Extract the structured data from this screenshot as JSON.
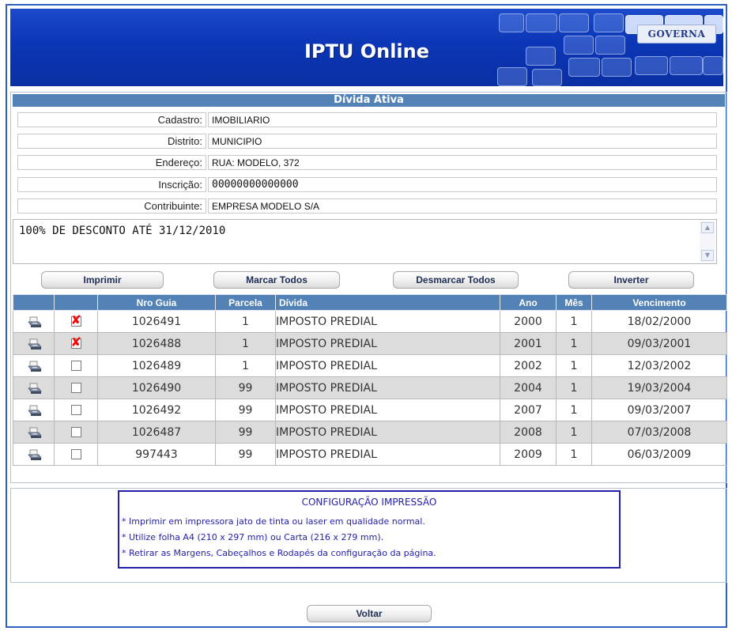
{
  "header": {
    "title": "IPTU Online",
    "logo_text": "GOVERNA"
  },
  "section_title": "Dívida Ativa",
  "fields": [
    {
      "label": "Cadastro:",
      "value": "IMOBILIARIO"
    },
    {
      "label": "Distrito:",
      "value": "MUNICIPIO"
    },
    {
      "label": "Endereço:",
      "value": "RUA: MODELO, 372"
    },
    {
      "label": "Inscrição:",
      "value": "00000000000000"
    },
    {
      "label": "Contribuinte:",
      "value": "EMPRESA MODELO S/A"
    }
  ],
  "message": "100% DE DESCONTO ATÉ 31/12/2010",
  "buttons": {
    "print": "Imprimir",
    "select_all": "Marcar Todos",
    "deselect_all": "Desmarcar Todos",
    "invert": "Inverter",
    "back": "Voltar"
  },
  "table": {
    "columns": [
      "",
      "",
      "Nro Guia",
      "Parcela",
      "Dívida",
      "Ano",
      "Mês",
      "Vencimento"
    ],
    "rows": [
      {
        "checked": true,
        "guia": "1026491",
        "parcela": "1",
        "divida": "IMPOSTO PREDIAL",
        "ano": "2000",
        "mes": "1",
        "vencimento": "18/02/2000"
      },
      {
        "checked": true,
        "guia": "1026488",
        "parcela": "1",
        "divida": "IMPOSTO PREDIAL",
        "ano": "2001",
        "mes": "1",
        "vencimento": "09/03/2001"
      },
      {
        "checked": false,
        "guia": "1026489",
        "parcela": "1",
        "divida": "IMPOSTO PREDIAL",
        "ano": "2002",
        "mes": "1",
        "vencimento": "12/03/2002"
      },
      {
        "checked": false,
        "guia": "1026490",
        "parcela": "99",
        "divida": "IMPOSTO PREDIAL",
        "ano": "2004",
        "mes": "1",
        "vencimento": "19/03/2004"
      },
      {
        "checked": false,
        "guia": "1026492",
        "parcela": "99",
        "divida": "IMPOSTO PREDIAL",
        "ano": "2007",
        "mes": "1",
        "vencimento": "09/03/2007"
      },
      {
        "checked": false,
        "guia": "1026487",
        "parcela": "99",
        "divida": "IMPOSTO PREDIAL",
        "ano": "2008",
        "mes": "1",
        "vencimento": "07/03/2008"
      },
      {
        "checked": false,
        "guia": "997443",
        "parcela": "99",
        "divida": "IMPOSTO PREDIAL",
        "ano": "2009",
        "mes": "1",
        "vencimento": "06/03/2009"
      }
    ]
  },
  "print_config": {
    "title": "CONFIGURAÇÃO IMPRESSÃO",
    "lines": [
      "* Imprimir em impressora jato de tinta ou laser em qualidade normal.",
      "* Utilize folha A4 (210 x 297 mm) ou Carta (216 x 279 mm).",
      "* Retirar as Margens, Cabeçalhos e Rodapés da configuração da página."
    ]
  },
  "colors": {
    "banner": "#0c36b6",
    "table_header": "#5282b6",
    "config_text": "#2420a9",
    "check_mark": "#ff0000"
  },
  "icons": {
    "row_action": "printer-icon",
    "row_select": "checkbox-icon"
  }
}
